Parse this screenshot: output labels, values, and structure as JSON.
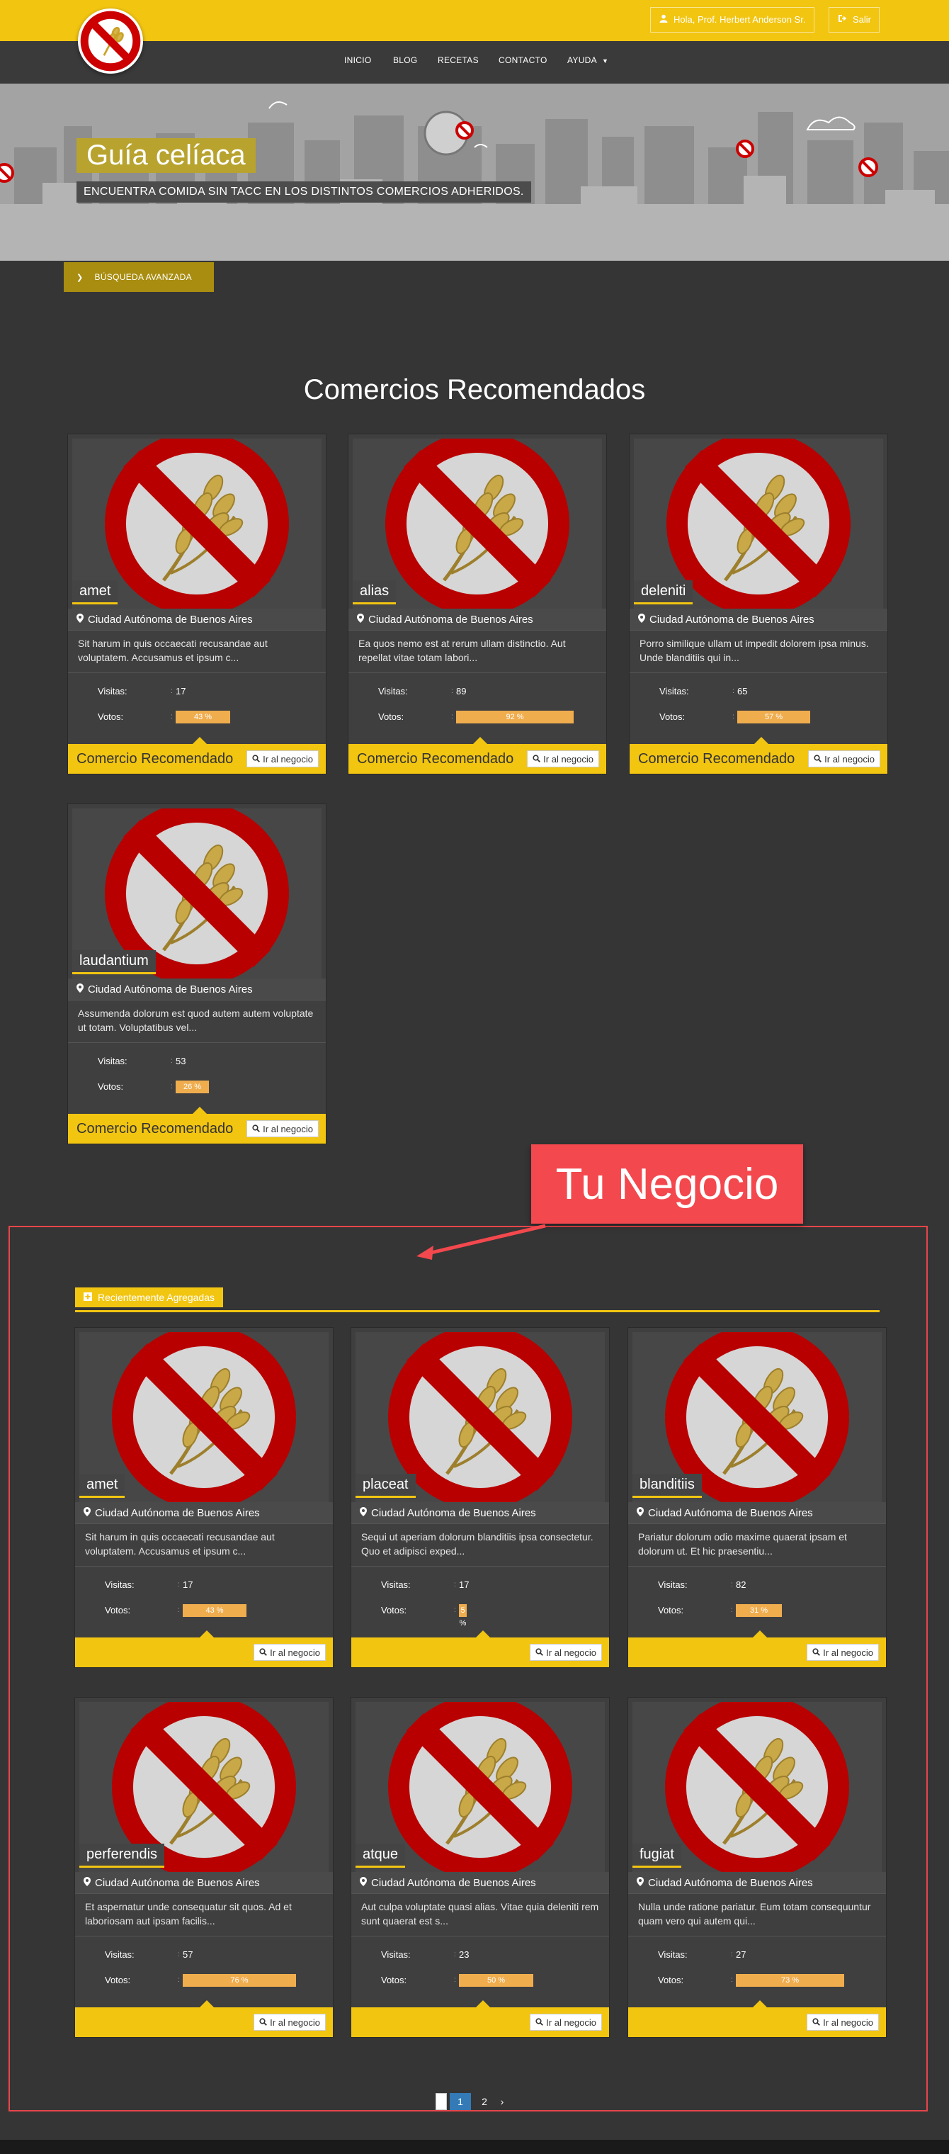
{
  "header": {
    "user_label": "Hola, Prof. Herbert Anderson Sr.",
    "logout_label": "Salir"
  },
  "nav": {
    "items": [
      "INICIO",
      "BLOG",
      "RECETAS",
      "CONTACTO",
      "AYUDA"
    ]
  },
  "hero": {
    "title": "Guía celíaca",
    "subtitle": "ENCUENTRA COMIDA SIN TACC EN LOS DISTINTOS COMERCIOS ADHERIDOS."
  },
  "advanced_search_label": "BÚSQUEDA AVANZADA",
  "recommended": {
    "title": "Comercios Recomendados",
    "footer_label": "Comercio Recomendado",
    "cards": [
      {
        "name": "amet",
        "location": "Ciudad Autónoma de Buenos Aires",
        "description": "Sit harum in quis occaecati recusandae aut voluptatem. Accusamus et ipsum c...",
        "visits": "17",
        "votes_pct": 43,
        "votes_label": "43 %"
      },
      {
        "name": "alias",
        "location": "Ciudad Autónoma de Buenos Aires",
        "description": "Ea quos nemo est at rerum ullam distinctio. Aut repellat vitae totam labori...",
        "visits": "89",
        "votes_pct": 92,
        "votes_label": "92 %"
      },
      {
        "name": "deleniti",
        "location": "Ciudad Autónoma de Buenos Aires",
        "description": "Porro similique ullam ut impedit dolorem ipsa minus. Unde blanditiis qui in...",
        "visits": "65",
        "votes_pct": 57,
        "votes_label": "57 %"
      },
      {
        "name": "laudantium",
        "location": "Ciudad Autónoma de Buenos Aires",
        "description": "Assumenda dolorum est quod autem autem voluptate ut totam. Voluptatibus vel...",
        "visits": "53",
        "votes_pct": 26,
        "votes_label": "26 %"
      }
    ]
  },
  "stats_labels": {
    "visits": "Visitas:",
    "votes": "Votos:"
  },
  "go_button_label": "Ir al negocio",
  "annotation": {
    "label": "Tu Negocio"
  },
  "recent": {
    "tag_label": "Recientemente Agregadas",
    "cards": [
      {
        "name": "amet",
        "location": "Ciudad Autónoma de Buenos Aires",
        "description": "Sit harum in quis occaecati recusandae aut voluptatem. Accusamus et ipsum c...",
        "visits": "17",
        "votes_pct": 43,
        "votes_label": "43 %"
      },
      {
        "name": "placeat",
        "location": "Ciudad Autónoma de Buenos Aires",
        "description": "Sequi ut aperiam dolorum blanditiis ipsa consectetur. Quo et adipisci exped...",
        "visits": "17",
        "votes_pct": 5,
        "votes_label": "5 %"
      },
      {
        "name": "blanditiis",
        "location": "Ciudad Autónoma de Buenos Aires",
        "description": "Pariatur dolorum odio maxime quaerat ipsam et dolorum ut. Et hic praesentiu...",
        "visits": "82",
        "votes_pct": 31,
        "votes_label": "31 %"
      },
      {
        "name": "perferendis",
        "location": "Ciudad Autónoma de Buenos Aires",
        "description": "Et aspernatur unde consequatur sit quos. Ad et laboriosam aut ipsam facilis...",
        "visits": "57",
        "votes_pct": 76,
        "votes_label": "76 %"
      },
      {
        "name": "atque",
        "location": "Ciudad Autónoma de Buenos Aires",
        "description": "Aut culpa voluptate quasi alias. Vitae quia deleniti rem sunt quaerat est s...",
        "visits": "23",
        "votes_pct": 50,
        "votes_label": "50 %"
      },
      {
        "name": "fugiat",
        "location": "Ciudad Autónoma de Buenos Aires",
        "description": "Nulla unde ratione pariatur. Eum totam consequuntur quam vero qui autem qui...",
        "visits": "27",
        "votes_pct": 73,
        "votes_label": "73 %"
      }
    ]
  },
  "pagination": {
    "pages": [
      "1",
      "2"
    ],
    "active": "1",
    "next": "›"
  },
  "colors": {
    "accent": "#f2c511",
    "dark": "#353535",
    "annotation": "#f3484d",
    "vote_bar": "#f0ad4e"
  }
}
